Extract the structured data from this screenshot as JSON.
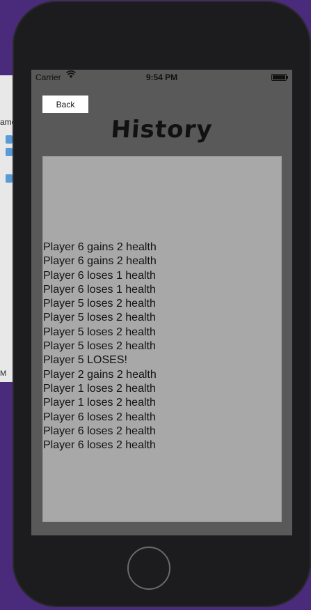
{
  "status_bar": {
    "carrier": "Carrier",
    "time": "9:54 PM",
    "wifi_icon": "wifi-icon",
    "battery_icon": "battery-icon"
  },
  "nav": {
    "back_label": "Back"
  },
  "page": {
    "title": "History"
  },
  "history": [
    "Player 6 gains 2 health",
    "Player 6 gains 2 health",
    "Player 6 loses 1 health",
    "Player 6 loses 1 health",
    "Player 5 loses 2 health",
    "Player 5 loses 2 health",
    "Player 5 loses 2 health",
    "Player 5 loses 2 health",
    "Player 5 LOSES!",
    "Player 2 gains 2 health",
    "Player 1 loses 2 health",
    "Player 1 loses 2 health",
    "Player 6 loses 2 health",
    "Player 6 loses 2 health",
    "Player 6 loses 2 health"
  ],
  "background_window": {
    "side_text": "ame",
    "bottom_text": "M"
  },
  "colors": {
    "desktop": "#4a2a7a",
    "screen": "#595959",
    "panel": "#a8a8a8"
  }
}
